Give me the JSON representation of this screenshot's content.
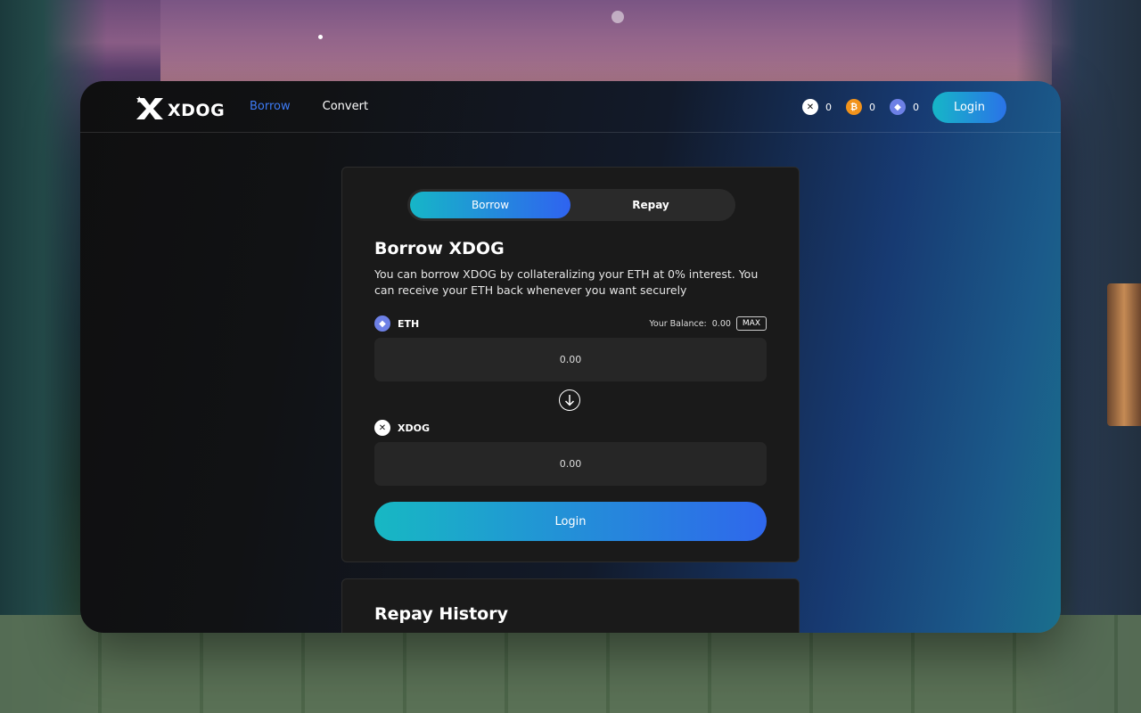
{
  "brand": {
    "name": "XDOG"
  },
  "nav": {
    "items": [
      {
        "label": "Borrow",
        "active": true
      },
      {
        "label": "Convert",
        "active": false
      }
    ]
  },
  "balances": [
    {
      "icon": "xdog-icon",
      "value": "0"
    },
    {
      "icon": "bitcoin-icon",
      "value": "0"
    },
    {
      "icon": "ethereum-icon",
      "value": "0"
    }
  ],
  "header": {
    "login_label": "Login"
  },
  "card": {
    "tabs": [
      {
        "label": "Borrow",
        "active": true
      },
      {
        "label": "Repay",
        "active": false
      }
    ],
    "title": "Borrow XDOG",
    "description": "You can borrow XDOG by collateralizing your ETH at 0% interest. You can receive your ETH back whenever you want securely",
    "from": {
      "token": "ETH",
      "balance_label": "Your Balance:",
      "balance_value": "0.00",
      "max_label": "MAX",
      "value": "0.00"
    },
    "to": {
      "token": "XDOG",
      "value": "0.00"
    },
    "login_label": "Login"
  },
  "history": {
    "title": "Repay History"
  },
  "colors": {
    "accent_start": "#16b6c7",
    "accent_end": "#2f63f0",
    "nav_active": "#3d7bf5"
  }
}
